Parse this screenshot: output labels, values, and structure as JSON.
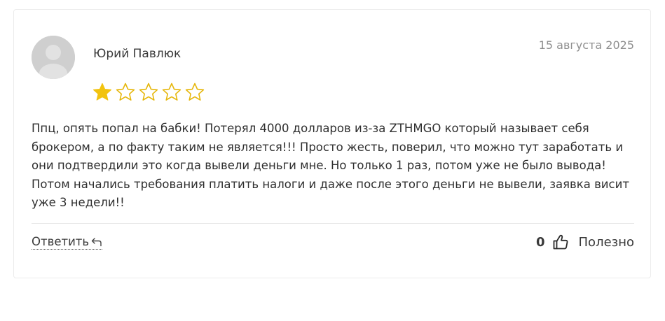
{
  "review": {
    "author": "Юрий Павлюк",
    "date": "15 августа 2025",
    "rating": 1,
    "max_rating": 5,
    "text": "Ппц, опять попал на бабки! Потерял 4000 долларов из-за ZTHMGO который называет себя брокером, а по факту таким не является!!! Просто жесть, поверил, что можно тут заработать и они подтвердили это когда вывели деньги мне. Но только 1 раз, потом уже не было вывода! Потом начались требования платить налоги и даже после этого деньги не вывели, заявка висит уже 3 недели!!"
  },
  "actions": {
    "reply_label": "Ответить",
    "useful_count": "0",
    "useful_label": "Полезно"
  },
  "colors": {
    "star_filled": "#f2c30f",
    "star_empty_stroke": "#e6b70c",
    "avatar_bg": "#cfcfcf"
  },
  "icons": {
    "reply": "reply-arrow-icon",
    "like": "thumbs-up-icon",
    "avatar": "user-avatar-icon"
  }
}
